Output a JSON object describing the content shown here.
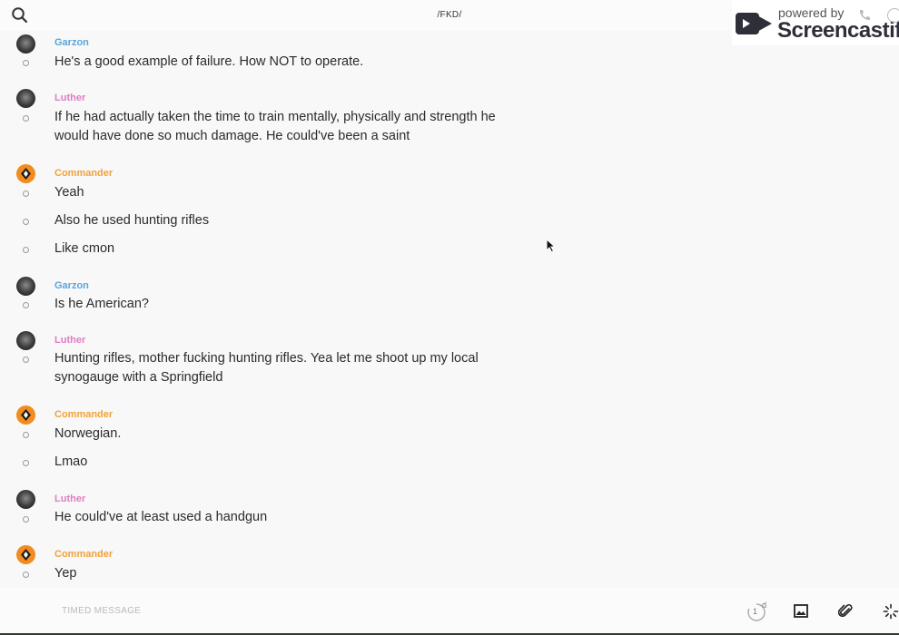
{
  "header": {
    "title": "/FKD/",
    "search_icon": "search-icon"
  },
  "watermark": {
    "powered_by": "powered by",
    "brand": "Screencastify"
  },
  "colors": {
    "garzon": "#5aa6d6",
    "luther": "#e07cc3",
    "commander": "#f0a23a"
  },
  "messages": [
    {
      "sender": "Garzon",
      "text": "He's a good example of failure. How NOT to operate."
    },
    {
      "sender": "Luther",
      "text": "If he had actually taken the time to train mentally, physically and strength he would have done so much damage. He could've been a saint"
    },
    {
      "sender": "Commander",
      "text": "Yeah"
    },
    {
      "sender": "",
      "text": "Also he used hunting rifles"
    },
    {
      "sender": "",
      "text": "Like cmon"
    },
    {
      "sender": "Garzon",
      "text": "Is he American?"
    },
    {
      "sender": "Luther",
      "text": "Hunting rifles, mother fucking hunting rifles. Yea let me shoot up my local synogauge with a Springfield"
    },
    {
      "sender": "Commander",
      "text": "Norwegian."
    },
    {
      "sender": "",
      "text": "Lmao"
    },
    {
      "sender": "Luther",
      "text": "He could've at least used a handgun"
    },
    {
      "sender": "Commander",
      "text": "Yep"
    }
  ],
  "composer": {
    "placeholder": "TIMED MESSAGE",
    "timer_value": "1",
    "timer_unit": "d",
    "icons": [
      "timer-icon",
      "image-icon",
      "paperclip-icon",
      "spinner-icon"
    ]
  }
}
